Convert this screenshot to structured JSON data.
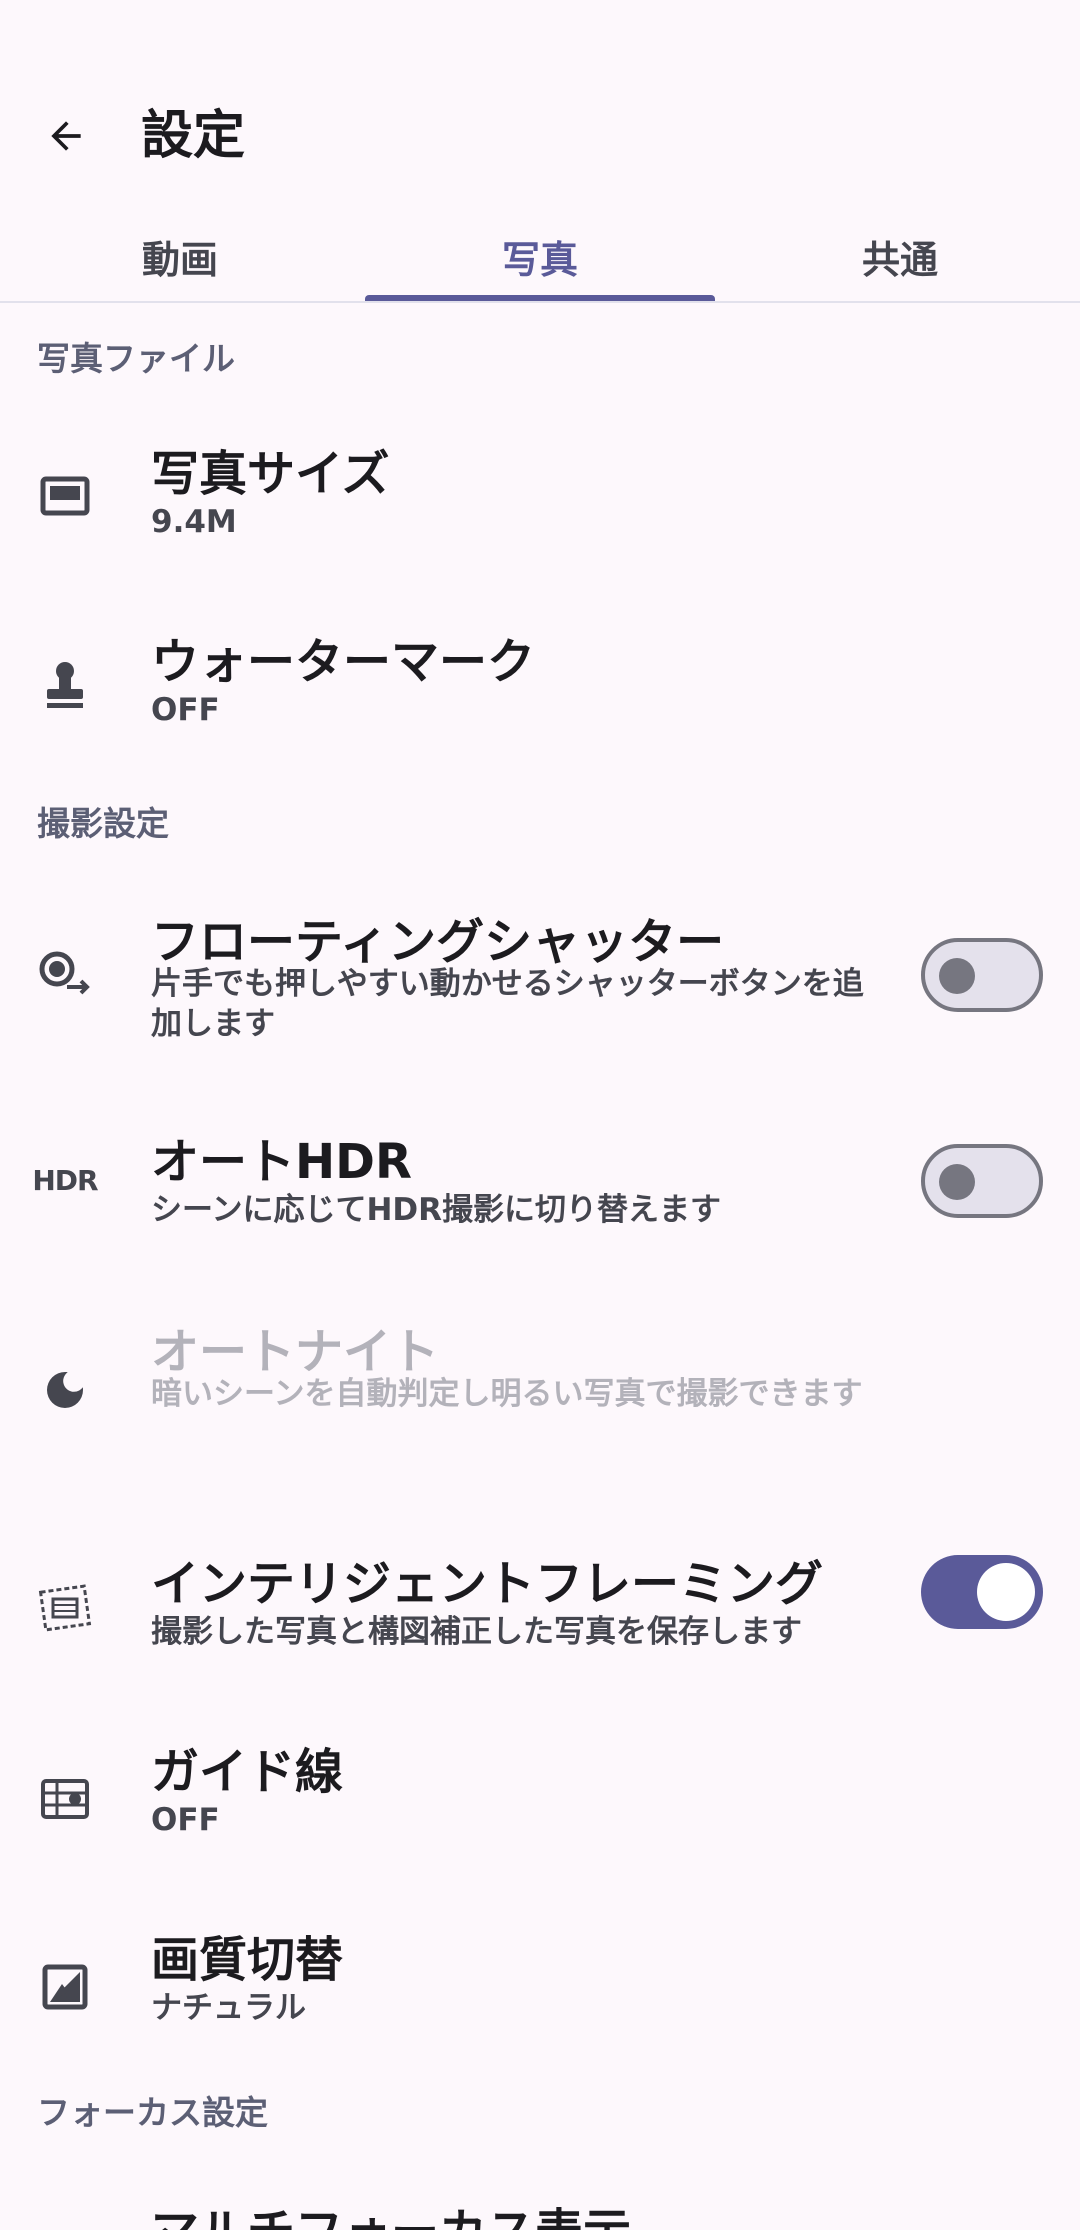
{
  "header": {
    "title": "設定",
    "back_icon": "arrow-back-icon"
  },
  "tabs": [
    {
      "label": "動画",
      "active": false
    },
    {
      "label": "写真",
      "active": true
    },
    {
      "label": "共通",
      "active": false
    }
  ],
  "colors": {
    "accent": "#5a5a99",
    "background": "#fdf8fc",
    "section_header": "#5c5f75"
  },
  "sections": [
    {
      "header": "写真ファイル",
      "items": [
        {
          "icon": "photo-size-icon",
          "title": "写真サイズ",
          "subtitle": "9.4M"
        },
        {
          "icon": "stamp-icon",
          "title": "ウォーターマーク",
          "subtitle": "OFF"
        }
      ]
    },
    {
      "header": "撮影設定",
      "items": [
        {
          "icon": "floating-shutter-icon",
          "title": "フローティングシャッター",
          "subtitle": "片手でも押しやすい動かせるシャッターボタンを追加します",
          "toggle": "off"
        },
        {
          "icon": "hdr-icon",
          "icon_text": "HDR",
          "title": "オートHDR",
          "subtitle": "シーンに応じてHDR撮影に切り替えます",
          "toggle": "off"
        },
        {
          "icon": "moon-icon",
          "title": "オートナイト",
          "subtitle": "暗いシーンを自動判定し明るい写真で撮影できます",
          "disabled": true
        },
        {
          "icon": "framing-icon",
          "title": "インテリジェントフレーミング",
          "subtitle": "撮影した写真と構図補正した写真を保存します",
          "toggle": "on"
        },
        {
          "icon": "grid-lines-icon",
          "title": "ガイド線",
          "subtitle": "OFF"
        },
        {
          "icon": "image-quality-icon",
          "title": "画質切替",
          "subtitle": "ナチュラル"
        }
      ]
    },
    {
      "header": "フォーカス設定",
      "items": [
        {
          "icon": "",
          "title": "マルチフォーカス表示"
        }
      ]
    }
  ]
}
